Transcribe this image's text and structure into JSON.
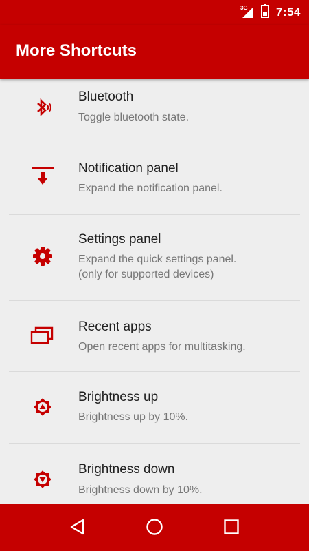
{
  "status_bar": {
    "network": "3G",
    "time": "7:54"
  },
  "app_bar": {
    "title": "More Shortcuts"
  },
  "accent_color": "#c50000",
  "shortcuts": [
    {
      "icon": "bluetooth-icon",
      "title": "Bluetooth",
      "description": "Toggle bluetooth state."
    },
    {
      "icon": "notification-panel-icon",
      "title": "Notification panel",
      "description": "Expand the notification panel."
    },
    {
      "icon": "settings-gear-icon",
      "title": "Settings panel",
      "description_lines": [
        "Expand the quick settings panel.",
        "(only for supported devices)"
      ]
    },
    {
      "icon": "recent-apps-icon",
      "title": "Recent apps",
      "description": "Open recent apps for multitasking."
    },
    {
      "icon": "brightness-up-icon",
      "title": "Brightness up",
      "description": "Brightness up by 10%."
    },
    {
      "icon": "brightness-down-icon",
      "title": "Brightness down",
      "description": "Brightness down by 10%."
    }
  ],
  "nav_bar": {
    "buttons": [
      "back-icon",
      "home-icon",
      "recents-icon"
    ]
  }
}
